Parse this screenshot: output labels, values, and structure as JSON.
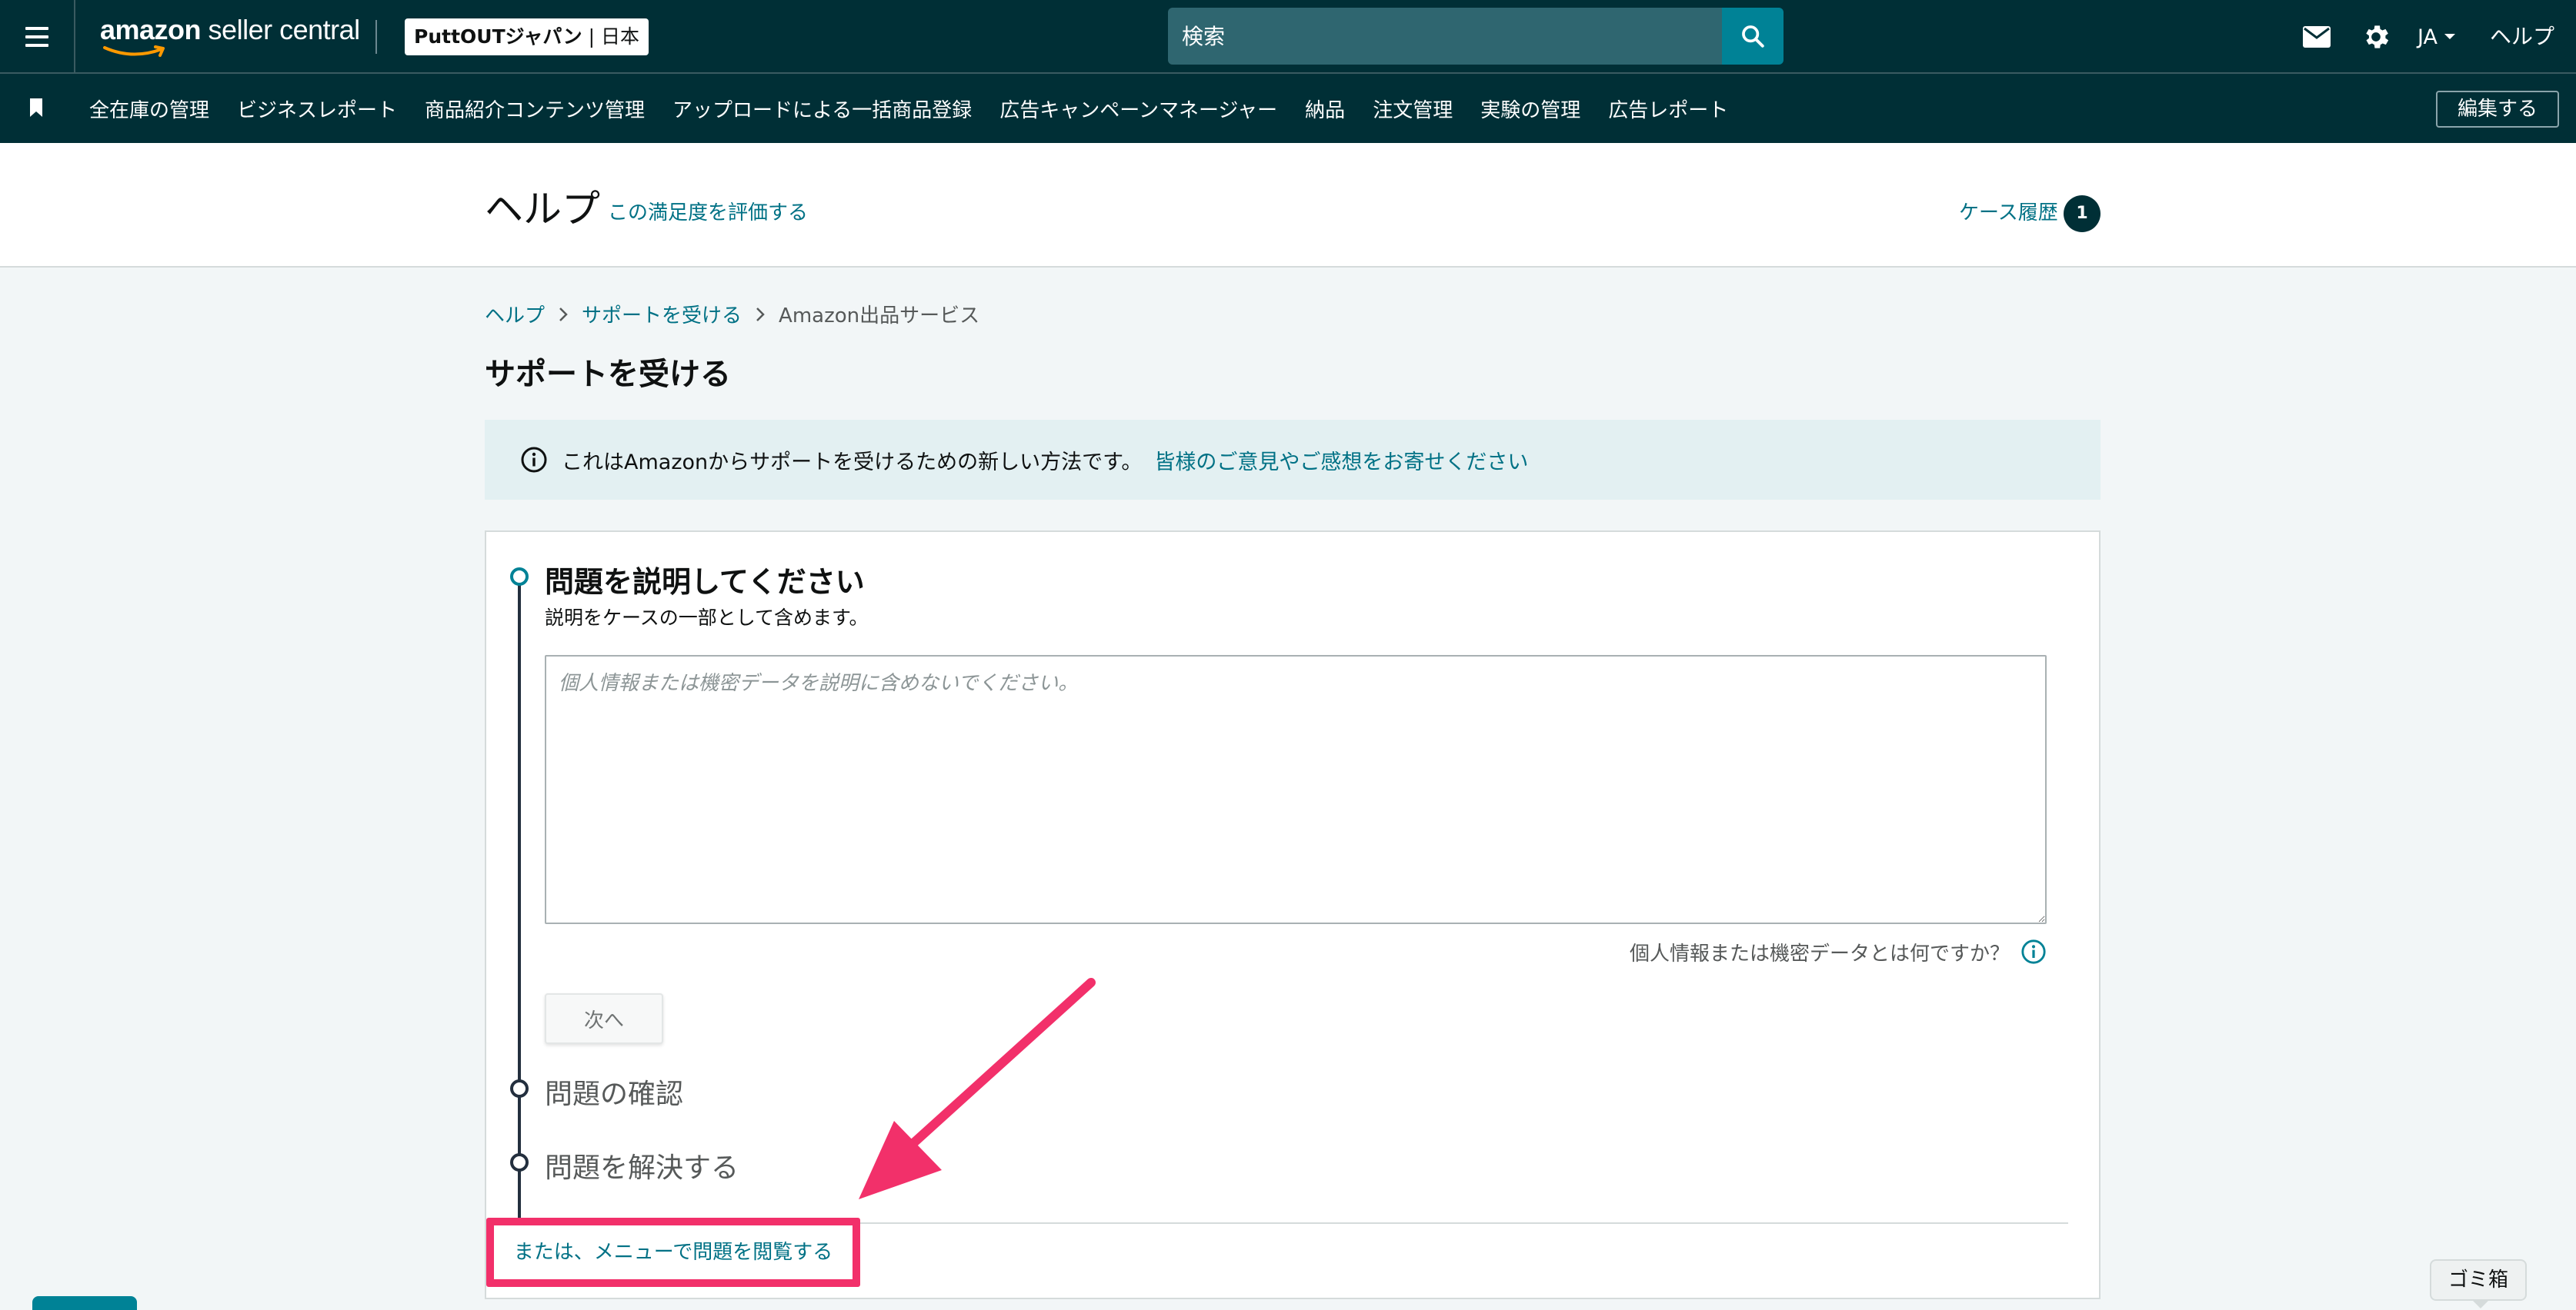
{
  "topbar": {
    "logo_bold": "amazon",
    "logo_light": " seller central",
    "store_name": "PuttOUTジャパン",
    "store_region": " | 日本",
    "search_placeholder": "検索",
    "language": "JA",
    "help_label": "ヘルプ"
  },
  "nav": {
    "items": [
      "全在庫の管理",
      "ビジネスレポート",
      "商品紹介コンテンツ管理",
      "アップロードによる一括商品登録",
      "広告キャンペーンマネージャー",
      "納品",
      "注文管理",
      "実験の管理",
      "広告レポート"
    ],
    "edit_label": "編集する"
  },
  "help_header": {
    "title": "ヘルプ",
    "rate_link": "この満足度を評価する",
    "case_history": "ケース履歴",
    "case_count": "1"
  },
  "breadcrumb": {
    "items": [
      "ヘルプ",
      "サポートを受ける",
      "Amazon出品サービス"
    ]
  },
  "page_title": "サポートを受ける",
  "banner": {
    "text": "これはAmazonからサポートを受けるための新しい方法です。",
    "link": "皆様のご意見やご感想をお寄せください"
  },
  "steps": {
    "step1_title": "問題を説明してください",
    "step1_subtitle": "説明をケースの一部として含めます。",
    "textarea_placeholder": "個人情報または機密データを説明に含めないでください。",
    "sensitive_help": "個人情報または機密データとは何ですか？",
    "next_label": "次へ",
    "step2_title": "問題の確認",
    "step3_title": "問題を解決する"
  },
  "browse_link": "または、メニューで問題を閲覧する",
  "trash_label": "ゴミ箱",
  "colors": {
    "header_bg": "#002f36",
    "link": "#007185",
    "teal_accent": "#008296",
    "annotation": "#f2306a",
    "banner_bg": "#e3f0f2"
  }
}
